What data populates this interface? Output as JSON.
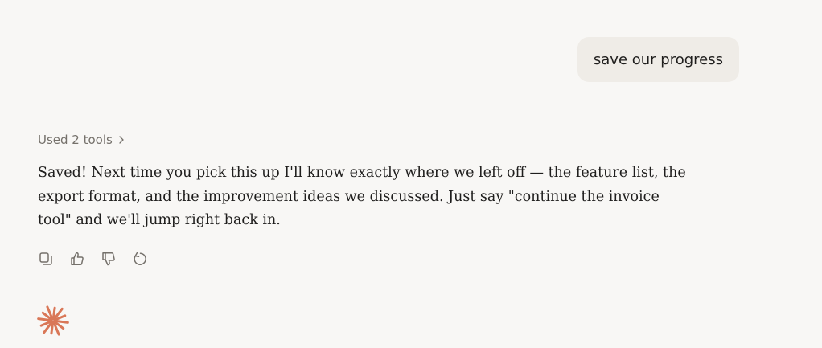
{
  "user_message": {
    "text": "save our progress"
  },
  "assistant": {
    "tools_summary": "Used 2 tools",
    "response_text": "Saved! Next time you pick this up I'll know exactly where we left off — the feature list, the export format, and the improvement ideas we discussed. Just say \"continue the invoice tool\" and we'll jump right back in.",
    "actions": [
      {
        "icon": "copy-icon"
      },
      {
        "icon": "thumbs-up-icon"
      },
      {
        "icon": "thumbs-down-icon"
      },
      {
        "icon": "retry-icon"
      }
    ]
  },
  "colors": {
    "background": "#f8f7f5",
    "user_bubble": "#efece7",
    "muted_text": "#75716b",
    "brand_accent": "#d97757"
  }
}
